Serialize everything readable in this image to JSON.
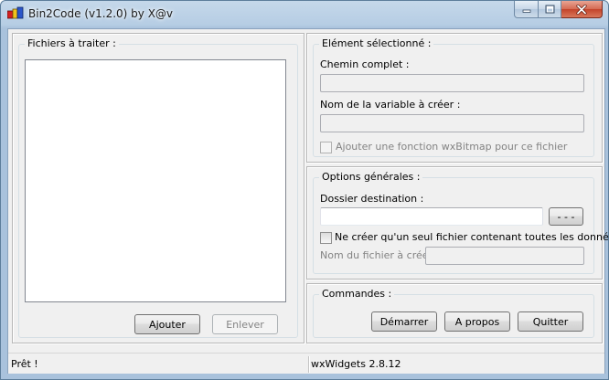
{
  "window": {
    "title": "Bin2Code (v1.2.0) by X@v"
  },
  "files_panel": {
    "legend": "Fichiers à traiter :",
    "files": [],
    "add_label": "Ajouter",
    "remove_label": "Enlever"
  },
  "selected": {
    "legend": "Elément sélectionné :",
    "full_path_label": "Chemin complet :",
    "full_path_value": "",
    "var_name_label": "Nom de la variable à créer :",
    "var_name_value": "",
    "bitmap_func_label": "Ajouter une fonction wxBitmap pour ce fichier",
    "bitmap_func_checked": false
  },
  "options": {
    "legend": "Options générales :",
    "dest_folder_label": "Dossier destination :",
    "dest_folder_value": "",
    "browse_label": "- - -",
    "single_file_label": "Ne créer qu'un seul fichier contenant toutes les données",
    "single_file_checked": false,
    "file_name_label": "Nom du fichier à créer :",
    "file_name_value": ""
  },
  "commands": {
    "legend": "Commandes :",
    "start_label": "Démarrer",
    "about_label": "A propos",
    "quit_label": "Quitter"
  },
  "statusbar": {
    "status": "Prêt !",
    "version": "wxWidgets 2.8.12"
  },
  "icons": {
    "app": "app-icon",
    "minimize": "minimize-icon",
    "maximize": "maximize-icon",
    "close": "close-icon"
  },
  "colors": {
    "titlebar": "#b6cde4",
    "close_button": "#c3432a",
    "client_background": "#f0f0f0"
  }
}
